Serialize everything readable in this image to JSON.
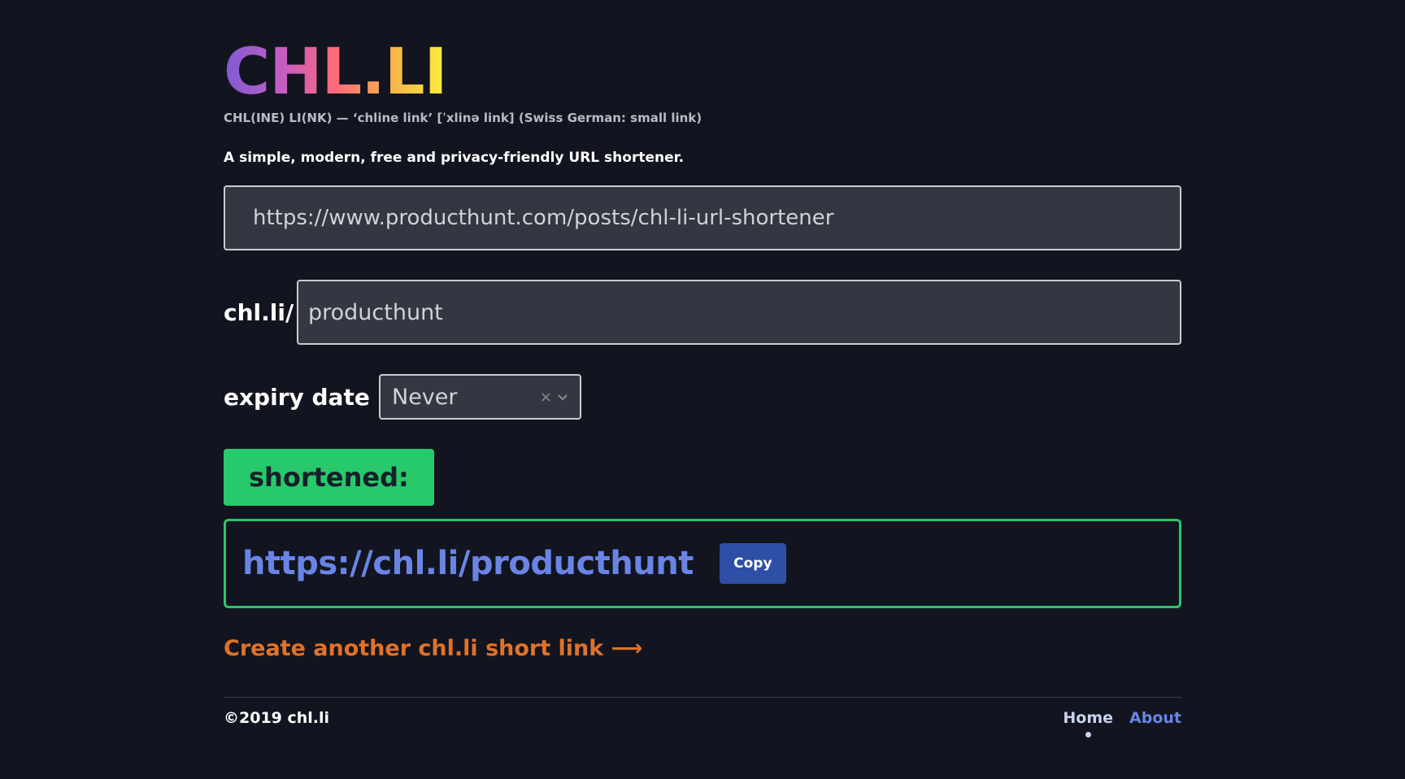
{
  "header": {
    "logo_text": "CHL.LI",
    "tagline": "CHL(INE) LI(NK) — ‘chline link’ [ˈxlinə link] (Swiss German: small link)",
    "description": "A simple, modern, free and privacy-friendly URL shortener."
  },
  "form": {
    "url_value": "https://www.producthunt.com/posts/chl-li-url-shortener",
    "slug_prefix": "chl.li/",
    "slug_value": "producthunt",
    "expiry_label": "expiry date",
    "expiry_value": "Never"
  },
  "result": {
    "badge": "shortened:",
    "short_url": "https://chl.li/producthunt",
    "copy_label": "Copy"
  },
  "create_another": "Create another chl.li short link ⟶",
  "footer": {
    "copyright": "©2019 chl.li",
    "nav": {
      "home": "Home",
      "about": "About"
    }
  },
  "colors": {
    "background": "#12151f",
    "accent_green": "#27c96b",
    "link_blue": "#6a84e6",
    "copy_button": "#2f4ea6",
    "create_link_orange": "#e0722a"
  },
  "icons": {
    "clear": "clear-icon",
    "dropdown": "chevron-down-icon"
  }
}
